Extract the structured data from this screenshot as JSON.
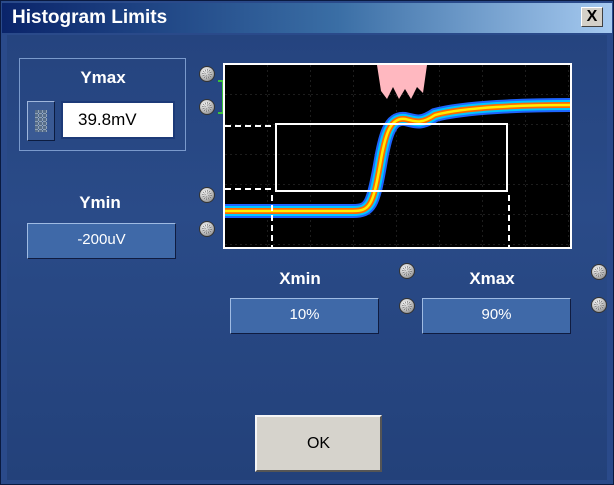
{
  "window": {
    "title": "Histogram Limits",
    "close_glyph": "X"
  },
  "ymax": {
    "label": "Ymax",
    "value": "39.8mV"
  },
  "ymin": {
    "label": "Ymin",
    "value": "-200uV"
  },
  "xmin": {
    "label": "Xmin",
    "value": "10%"
  },
  "xmax": {
    "label": "Xmax",
    "value": "90%"
  },
  "ok_label": "OK",
  "icons": {
    "keypad": "keypad-icon",
    "knob": "adjust-knob-icon"
  },
  "colors": {
    "title_start": "#0a246a",
    "panel": "#2a4b88",
    "field": "#3f69a8",
    "trace_core": "#ffee00",
    "trace_edge": "#00c8ff",
    "box": "#ffffff"
  }
}
